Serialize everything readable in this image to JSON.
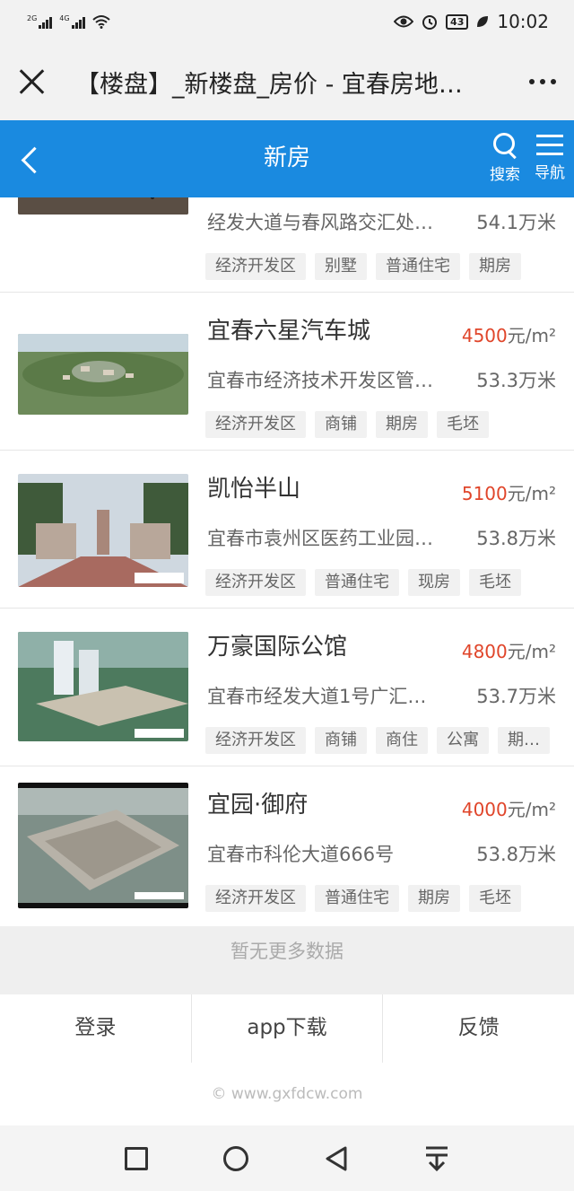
{
  "status_bar": {
    "net1": "2G",
    "net2": "4G",
    "battery": "43",
    "time": "10:02"
  },
  "title_bar": {
    "title": "【楼盘】_新楼盘_房价 - 宜春房地…"
  },
  "header": {
    "title": "新房",
    "search_label": "搜索",
    "nav_label": "导航"
  },
  "listings": [
    {
      "name": "",
      "price_value": "",
      "price_unit": "",
      "address": "经发大道与春风路交汇处…",
      "area": "54.1万米",
      "tags": [
        "经济开发区",
        "别墅",
        "普通住宅",
        "期房"
      ]
    },
    {
      "name": "宜春六星汽车城",
      "price_value": "4500",
      "price_unit": "元/m²",
      "address": "宜春市经济技术开发区管…",
      "area": "53.3万米",
      "tags": [
        "经济开发区",
        "商铺",
        "期房",
        "毛坯"
      ]
    },
    {
      "name": "凯怡半山",
      "price_value": "5100",
      "price_unit": "元/m²",
      "address": "宜春市袁州区医药工业园…",
      "area": "53.8万米",
      "tags": [
        "经济开发区",
        "普通住宅",
        "现房",
        "毛坯"
      ]
    },
    {
      "name": "万豪国际公馆",
      "price_value": "4800",
      "price_unit": "元/m²",
      "address": "宜春市经发大道1号广汇…",
      "area": "53.7万米",
      "tags": [
        "经济开发区",
        "商铺",
        "商住",
        "公寓",
        "期…"
      ]
    },
    {
      "name": "宜园·御府",
      "price_value": "4000",
      "price_unit": "元/m²",
      "address": "宜春市科伦大道666号",
      "area": "53.8万米",
      "tags": [
        "经济开发区",
        "普通住宅",
        "期房",
        "毛坯"
      ]
    }
  ],
  "footer": {
    "no_more": "暂无更多数据",
    "login": "登录",
    "app_download": "app下载",
    "feedback": "反馈",
    "copyright": "© www.gxfdcw.com"
  }
}
